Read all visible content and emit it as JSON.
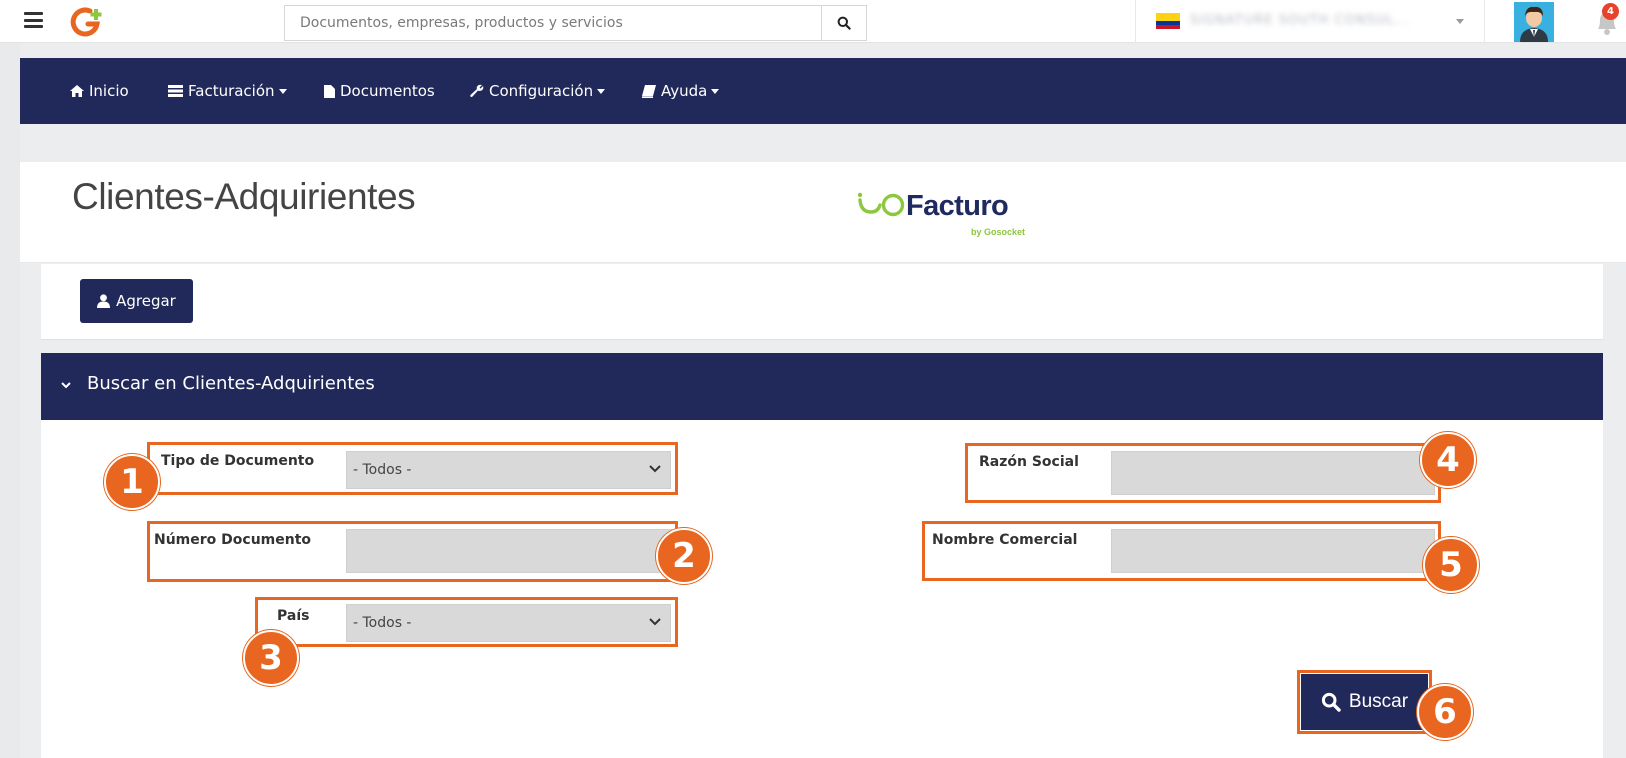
{
  "topbar": {
    "search_placeholder": "Documentos, empresas, productos y servicios",
    "company_name": "SIGNATURE SOUTH CONSUL...",
    "notifications_count": "4"
  },
  "nav": {
    "items": [
      {
        "label": "Inicio"
      },
      {
        "label": "Facturación"
      },
      {
        "label": "Documentos"
      },
      {
        "label": "Configuración"
      },
      {
        "label": "Ayuda"
      }
    ]
  },
  "header": {
    "title": "Clientes-Adquirientes",
    "brand_word": "Facturo",
    "brand_by": "by Gosocket"
  },
  "toolbar": {
    "add_label": "Agregar"
  },
  "search": {
    "panel_title": "Buscar en Clientes-Adquirientes",
    "tipo_documento_label": "Tipo de Documento",
    "tipo_documento_value": "- Todos -",
    "numero_documento_label": "Número Documento",
    "numero_documento_value": "",
    "pais_label": "País",
    "pais_value": "- Todos -",
    "razon_social_label": "Razón Social",
    "razon_social_value": "",
    "nombre_comercial_label": "Nombre Comercial",
    "nombre_comercial_value": "",
    "buscar_label": "Buscar"
  },
  "callouts": [
    "1",
    "2",
    "3",
    "4",
    "5",
    "6"
  ],
  "colors": {
    "navy": "#21295a",
    "callout_orange": "#e8661f",
    "brand_green": "#8dc63f",
    "badge_red": "#e8412c"
  }
}
